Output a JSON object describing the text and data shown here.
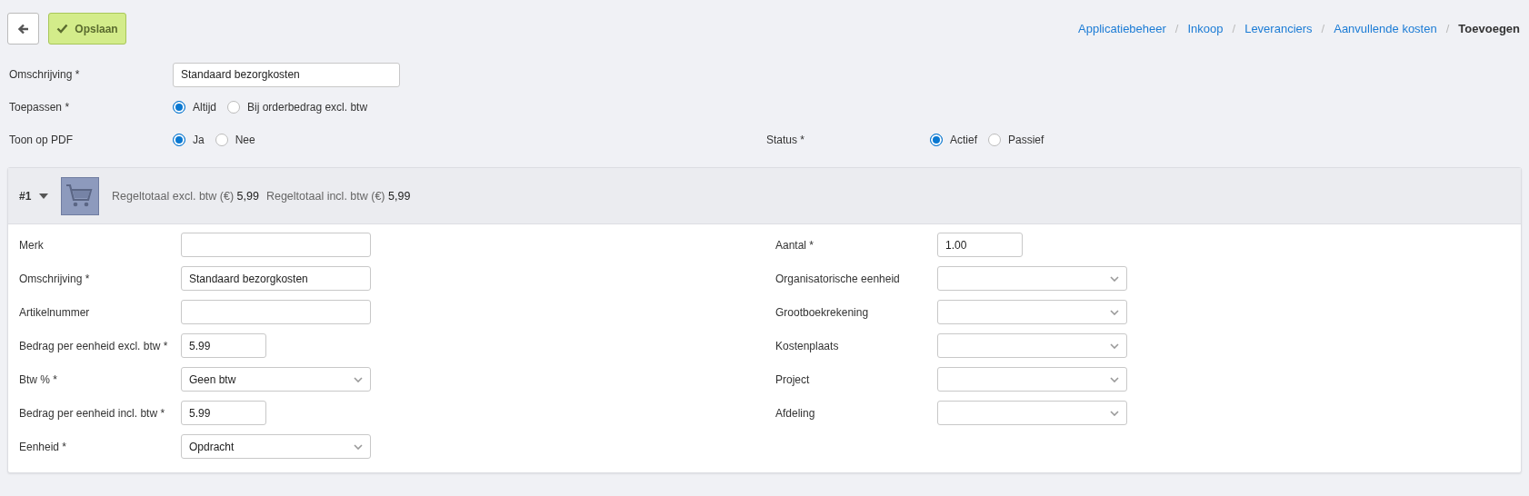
{
  "toolbar": {
    "save_label": "Opslaan"
  },
  "breadcrumb": [
    {
      "label": "Applicatiebeheer",
      "current": false
    },
    {
      "label": "Inkoop",
      "current": false
    },
    {
      "label": "Leveranciers",
      "current": false
    },
    {
      "label": "Aanvullende kosten",
      "current": false
    },
    {
      "label": "Toevoegen",
      "current": true
    }
  ],
  "breadcrumb_separators": [
    "/",
    "/",
    "/",
    "/"
  ],
  "form": {
    "description": {
      "label": "Omschrijving *",
      "value": "Standaard bezorgkosten"
    },
    "apply": {
      "label": "Toepassen *",
      "options": [
        {
          "label": "Altijd",
          "selected": true
        },
        {
          "label": "Bij orderbedrag excl. btw",
          "selected": false
        }
      ]
    },
    "show_on_pdf": {
      "label": "Toon op PDF",
      "options": [
        {
          "label": "Ja",
          "selected": true
        },
        {
          "label": "Nee",
          "selected": false
        }
      ]
    },
    "status": {
      "label": "Status *",
      "options": [
        {
          "label": "Actief",
          "selected": true
        },
        {
          "label": "Passief",
          "selected": false
        }
      ]
    }
  },
  "line": {
    "number": "#1",
    "expanded": true,
    "totals": [
      {
        "label": "Regeltotaal excl. btw (€)",
        "value": "5,99"
      },
      {
        "label": "Regeltotaal incl. btw (€)",
        "value": "5,99"
      }
    ],
    "left_fields": [
      {
        "label": "Merk",
        "kind": "text"
      },
      {
        "label": "Omschrijving *",
        "kind": "text",
        "value": "Standaard bezorgkosten"
      },
      {
        "label": "Artikelnummer",
        "kind": "text"
      },
      {
        "label": "Bedrag per eenheid excl. btw *",
        "kind": "number",
        "value": "5.99"
      },
      {
        "label": "Btw % *",
        "kind": "select",
        "value": "Geen btw"
      },
      {
        "label": "Bedrag per eenheid incl. btw *",
        "kind": "number",
        "value": "5.99"
      },
      {
        "label": "Eenheid *",
        "kind": "select",
        "value": "Opdracht"
      }
    ],
    "right_fields": [
      {
        "label": "Aantal *",
        "kind": "number",
        "value": "1.00"
      },
      {
        "label": "Organisatorische eenheid",
        "kind": "select"
      },
      {
        "label": "Grootboekrekening",
        "kind": "select"
      },
      {
        "label": "Kostenplaats",
        "kind": "select"
      },
      {
        "label": "Project",
        "kind": "select"
      },
      {
        "label": "Afdeling",
        "kind": "select"
      }
    ]
  }
}
